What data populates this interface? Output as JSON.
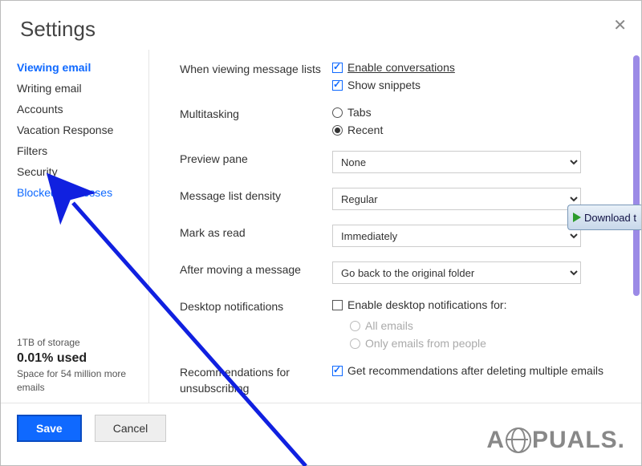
{
  "header": {
    "title": "Settings"
  },
  "sidebar": {
    "items": [
      {
        "label": "Viewing email"
      },
      {
        "label": "Writing email"
      },
      {
        "label": "Accounts"
      },
      {
        "label": "Vacation Response"
      },
      {
        "label": "Filters"
      },
      {
        "label": "Security"
      },
      {
        "label": "Blocked Addresses"
      }
    ],
    "storage": {
      "total": "1TB of storage",
      "percent_used": "0.01% used",
      "remaining": "Space for 54 million more emails"
    }
  },
  "settings": {
    "viewing_lists": {
      "label": "When viewing message lists",
      "enable_conversations": "Enable conversations",
      "show_snippets": "Show snippets"
    },
    "multitasking": {
      "label": "Multitasking",
      "tabs": "Tabs",
      "recent": "Recent"
    },
    "preview_pane": {
      "label": "Preview pane",
      "value": "None"
    },
    "density": {
      "label": "Message list density",
      "value": "Regular"
    },
    "mark_read": {
      "label": "Mark as read",
      "value": "Immediately"
    },
    "after_move": {
      "label": "After moving a message",
      "value": "Go back to the original folder"
    },
    "desktop_notif": {
      "label": "Desktop notifications",
      "enable": "Enable desktop notifications for:",
      "all": "All emails",
      "people": "Only emails from people"
    },
    "recommendations": {
      "label": "Recommendations for unsubscribing",
      "text": "Get recommendations after deleting multiple emails"
    }
  },
  "footer": {
    "save": "Save",
    "cancel": "Cancel"
  },
  "badge": {
    "text": "Download t"
  },
  "watermark": {
    "prefix": "A",
    "suffix": "PUALS."
  }
}
